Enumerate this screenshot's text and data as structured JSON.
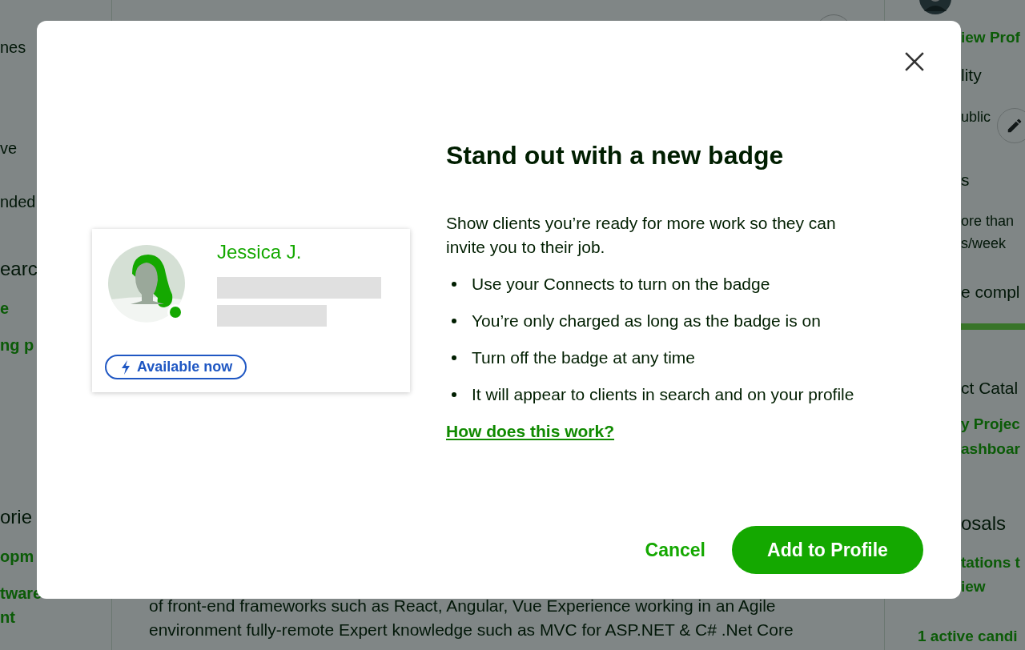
{
  "background": {
    "left_sidebar": [
      {
        "kind": "text",
        "text": "nes"
      },
      {
        "kind": "text",
        "text": "ve"
      },
      {
        "kind": "text",
        "text": "nded"
      },
      {
        "kind": "heading",
        "text": "earc"
      },
      {
        "kind": "link",
        "text": "e"
      },
      {
        "kind": "link",
        "text": "ng p"
      },
      {
        "kind": "heading",
        "text": "orie"
      },
      {
        "kind": "link",
        "text": "opm"
      },
      {
        "kind": "link",
        "text": "tware"
      },
      {
        "kind": "link",
        "text": "nt"
      }
    ],
    "feed": {
      "text_lines": [
        "of front-end frameworks such as React, Angular, Vue Experience working in an Agile",
        "environment fully-remote Expert knowledge such as MVC for ASP.NET & C# .Net Core"
      ]
    },
    "right_sidebar": [
      {
        "kind": "avatar"
      },
      {
        "kind": "link",
        "text": "iew Prof"
      },
      {
        "kind": "heading",
        "text": "lity"
      },
      {
        "kind": "editable",
        "text": "ublic"
      },
      {
        "kind": "heading",
        "text": "s"
      },
      {
        "kind": "text",
        "text": "ore than"
      },
      {
        "kind": "text",
        "text": "s/week"
      },
      {
        "kind": "heading",
        "text": "e compl"
      },
      {
        "kind": "progress",
        "level": 1
      },
      {
        "kind": "heading",
        "text": "ct Catal"
      },
      {
        "kind": "link",
        "text": "y Projec"
      },
      {
        "kind": "link",
        "text": "ashboar"
      },
      {
        "kind": "heading",
        "text": "osals"
      },
      {
        "kind": "link",
        "text": "tations t"
      },
      {
        "kind": "link",
        "text": "iew"
      },
      {
        "kind": "link",
        "text": "1 active candi"
      }
    ]
  },
  "modal": {
    "title": "Stand out with a new badge",
    "profile_card": {
      "name": "Jessica J.",
      "badge": "Available now"
    },
    "description": "Show clients you’re ready for more work so they can invite you to their job.",
    "bullets": [
      "Use your Connects to turn on the badge",
      "You’re only charged as long as the badge is on",
      "Turn off the badge at any time",
      "It will appear to clients in search and on your profile"
    ],
    "link": "How does this work?",
    "buttons": {
      "cancel": "Cancel",
      "primary": "Add to Profile"
    }
  }
}
